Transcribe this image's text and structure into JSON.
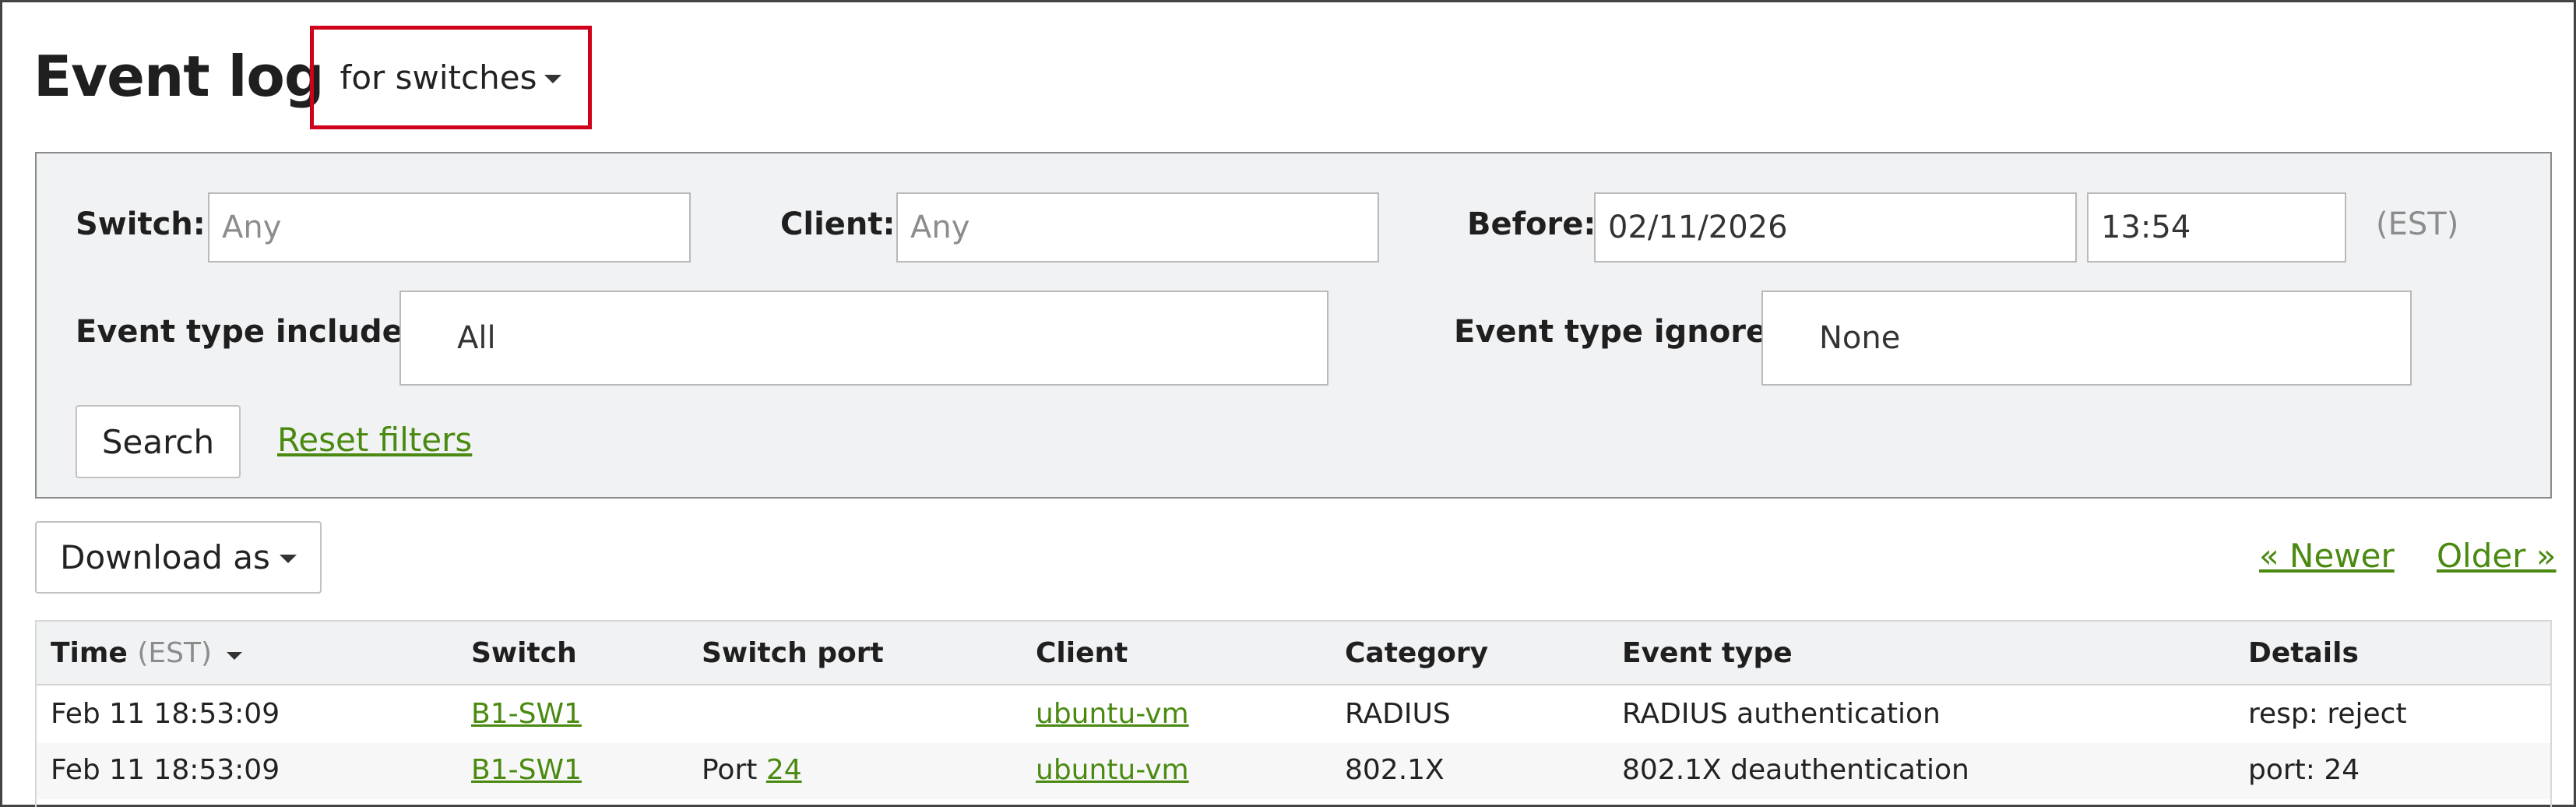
{
  "header": {
    "title": "Event log",
    "scope_dropdown": "for switches"
  },
  "filters": {
    "switch_label": "Switch:",
    "switch_placeholder": "Any",
    "client_label": "Client:",
    "client_placeholder": "Any",
    "before_label": "Before:",
    "before_date": "02/11/2026",
    "before_time": "13:54",
    "timezone": "(EST)",
    "include_label": "Event type include:",
    "include_value": "All",
    "ignore_label": "Event type ignore:",
    "ignore_value": "None",
    "search_button": "Search",
    "reset_link": "Reset filters"
  },
  "toolbar": {
    "download_button": "Download as",
    "newer_link": "« Newer",
    "older_link": "Older »"
  },
  "table": {
    "columns": {
      "time": "Time",
      "time_tz": "(EST)",
      "switch": "Switch",
      "switch_port": "Switch port",
      "client": "Client",
      "category": "Category",
      "event_type": "Event type",
      "details": "Details"
    },
    "rows": [
      {
        "time": "Feb 11 18:53:09",
        "switch": "B1-SW1",
        "port_prefix": "",
        "port_link": "",
        "client": "ubuntu-vm",
        "category": "RADIUS",
        "event_type": "RADIUS authentication",
        "details": "resp: reject"
      },
      {
        "time": "Feb 11 18:53:09",
        "switch": "B1-SW1",
        "port_prefix": "Port",
        "port_link": "24",
        "client": "ubuntu-vm",
        "category": "802.1X",
        "event_type": "802.1X deauthentication",
        "details": "port: 24"
      }
    ]
  }
}
